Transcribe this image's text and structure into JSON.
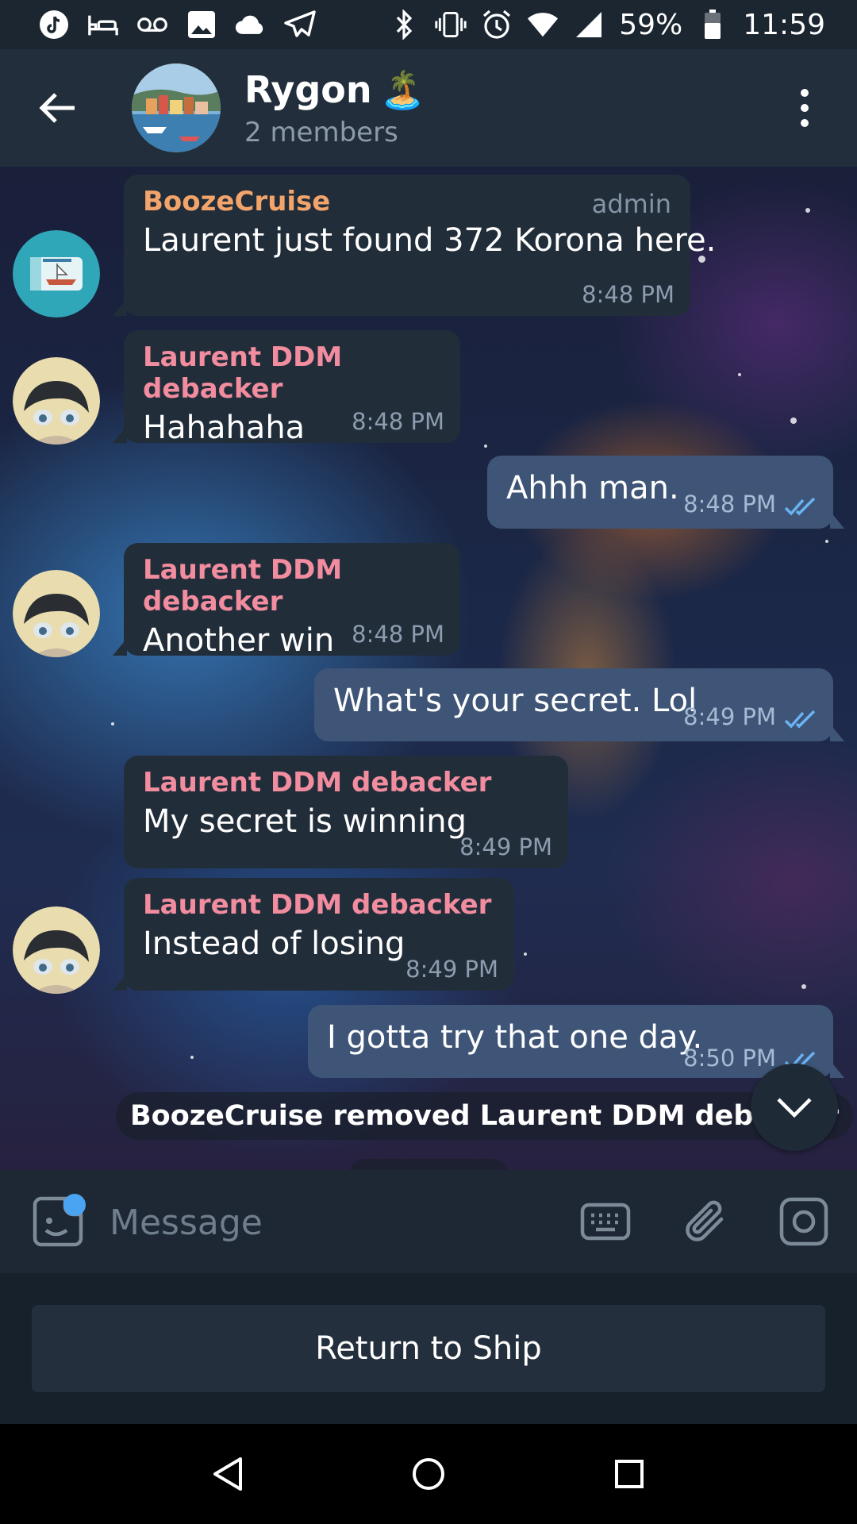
{
  "status_bar": {
    "battery": "59%",
    "time": "11:59",
    "left_icons": [
      "tiktok-icon",
      "bed-icon",
      "voicemail-icon",
      "image-icon",
      "cloud-icon",
      "telegram-icon"
    ],
    "right_icons": [
      "bluetooth-icon",
      "vibrate-icon",
      "alarm-icon",
      "wifi-icon",
      "signal-icon",
      "battery-icon"
    ]
  },
  "header": {
    "title": "Rygon",
    "title_emoji": "🏝️",
    "subtitle": "2 members"
  },
  "messages": [
    {
      "sender": "BoozeCruise",
      "tag": "admin",
      "text": "Laurent just found 372 Korona here.",
      "time": "8:48 PM",
      "direction": "in"
    },
    {
      "sender": "Laurent DDM debacker",
      "text": "Hahahaha",
      "time": "8:48 PM",
      "direction": "in"
    },
    {
      "text": "Ahhh man.",
      "time": "8:48 PM",
      "direction": "out",
      "status": "read"
    },
    {
      "sender": "Laurent DDM debacker",
      "text": "Another win",
      "time": "8:48 PM",
      "direction": "in"
    },
    {
      "text": "What's your secret. Lol",
      "time": "8:49 PM",
      "direction": "out",
      "status": "read"
    },
    {
      "sender": "Laurent DDM debacker",
      "text": "My secret is winning",
      "time": "8:49 PM",
      "direction": "in"
    },
    {
      "sender": "Laurent DDM debacker",
      "text": "Instead of losing",
      "time": "8:49 PM",
      "direction": "in"
    },
    {
      "text": "I gotta try that one day.",
      "time": "8:50 PM",
      "direction": "out",
      "status": "read"
    }
  ],
  "service_message": "BoozeCruise removed Laurent DDM debacker",
  "input": {
    "placeholder": "Message"
  },
  "return_button": "Return to Ship",
  "colors": {
    "header_bg": "#222e3b",
    "incoming_bubble": "#222d3a",
    "outgoing_bubble": "#3e5577",
    "sender_pink": "#f28c9f",
    "sender_orange": "#f3a46b",
    "accent_blue": "#4aa4f1"
  }
}
